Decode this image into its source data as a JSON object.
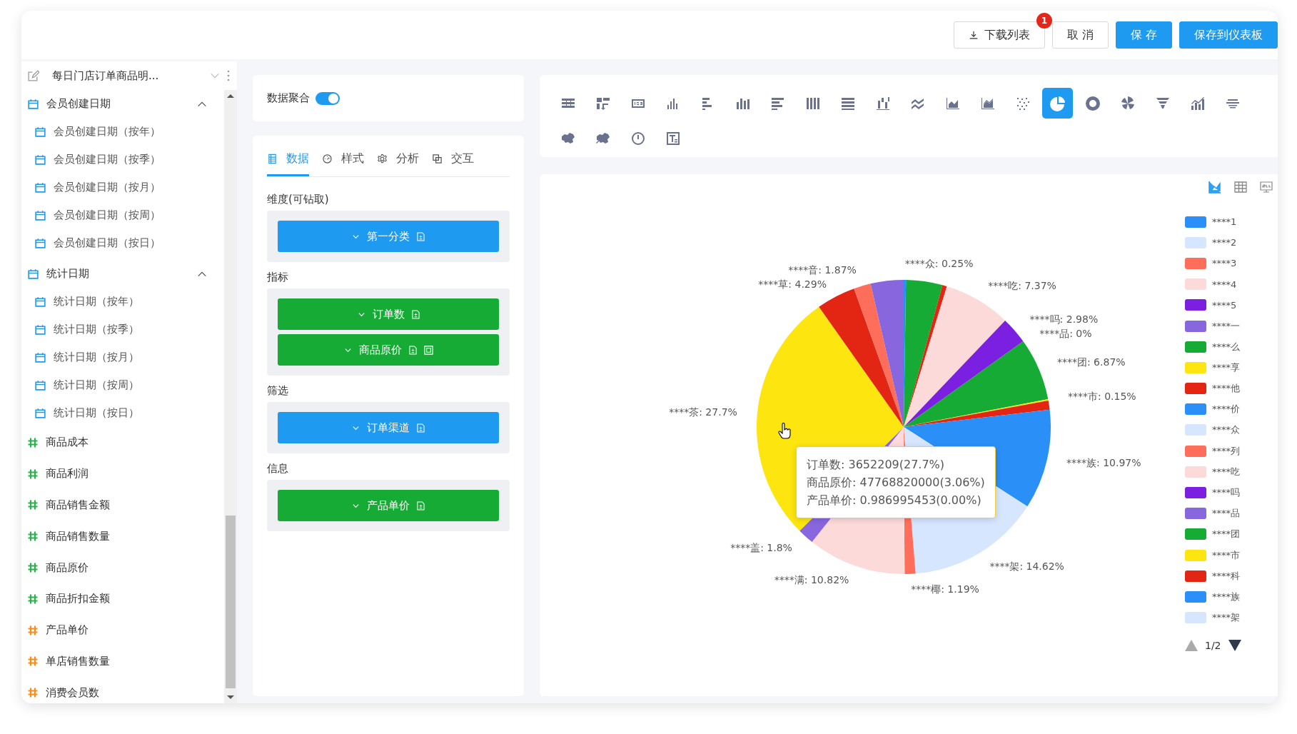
{
  "header": {
    "buttons": [
      {
        "label": "下载列表",
        "kind": "download",
        "badge": "1"
      },
      {
        "label": "取 消",
        "kind": "outline"
      },
      {
        "label": "保 存",
        "kind": "primary"
      },
      {
        "label": "保存到仪表板",
        "kind": "primary"
      }
    ]
  },
  "sidebar": {
    "dataset_title": "每日门店订单商品明...",
    "fields": [
      {
        "kind": "date-group",
        "label": "会员创建日期",
        "expanded": true,
        "children": [
          {
            "kind": "date",
            "label": "会员创建日期（按年）"
          },
          {
            "kind": "date",
            "label": "会员创建日期（按季）"
          },
          {
            "kind": "date",
            "label": "会员创建日期（按月）"
          },
          {
            "kind": "date",
            "label": "会员创建日期（按周）"
          },
          {
            "kind": "date",
            "label": "会员创建日期（按日）"
          }
        ]
      },
      {
        "kind": "date-group",
        "label": "统计日期",
        "expanded": true,
        "children": [
          {
            "kind": "date",
            "label": "统计日期（按年）"
          },
          {
            "kind": "date",
            "label": "统计日期（按季）"
          },
          {
            "kind": "date",
            "label": "统计日期（按月）"
          },
          {
            "kind": "date",
            "label": "统计日期（按周）"
          },
          {
            "kind": "date",
            "label": "统计日期（按日）"
          }
        ]
      },
      {
        "kind": "measure",
        "label": "商品成本",
        "color": "#2bb24c"
      },
      {
        "kind": "measure",
        "label": "商品利润",
        "color": "#2bb24c"
      },
      {
        "kind": "measure",
        "label": "商品销售金额",
        "color": "#2bb24c"
      },
      {
        "kind": "measure",
        "label": "商品销售数量",
        "color": "#2bb24c"
      },
      {
        "kind": "measure",
        "label": "商品原价",
        "color": "#2bb24c"
      },
      {
        "kind": "measure",
        "label": "商品折扣金额",
        "color": "#2bb24c"
      },
      {
        "kind": "measure",
        "label": "产品单价",
        "color": "#fa8c16"
      },
      {
        "kind": "measure",
        "label": "单店销售数量",
        "color": "#fa8c16"
      },
      {
        "kind": "measure",
        "label": "消费会员数",
        "color": "#fa8c16"
      }
    ]
  },
  "aggregate": {
    "label": "数据聚合",
    "on": true
  },
  "tabs": [
    {
      "label": "数据",
      "selected": true
    },
    {
      "label": "样式",
      "selected": false
    },
    {
      "label": "分析",
      "selected": false
    },
    {
      "label": "交互",
      "selected": false
    }
  ],
  "sections": [
    {
      "title": "维度(可钻取)",
      "fields": [
        {
          "label": "第一分类",
          "kind": "dimension",
          "extra_icon": false
        }
      ]
    },
    {
      "title": "指标",
      "fields": [
        {
          "label": "订单数",
          "kind": "measure",
          "extra_icon": false
        },
        {
          "label": "商品原价",
          "kind": "measure",
          "extra_icon": true
        }
      ]
    },
    {
      "title": "筛选",
      "fields": [
        {
          "label": "订单渠道",
          "kind": "dimension",
          "extra_icon": false
        }
      ]
    },
    {
      "title": "信息",
      "fields": [
        {
          "label": "产品单价",
          "kind": "measure",
          "extra_icon": false
        }
      ]
    }
  ],
  "chart_types": [
    {
      "kind": "table",
      "selected": false
    },
    {
      "kind": "pivot",
      "selected": false
    },
    {
      "kind": "number",
      "selected": false
    },
    {
      "kind": "bar-small",
      "selected": false
    },
    {
      "kind": "hbar",
      "selected": false
    },
    {
      "kind": "bar",
      "selected": false
    },
    {
      "kind": "hbar-long",
      "selected": false
    },
    {
      "kind": "column-stack",
      "selected": false
    },
    {
      "kind": "row-stack",
      "selected": false
    },
    {
      "kind": "waterfall",
      "selected": false
    },
    {
      "kind": "line",
      "selected": false
    },
    {
      "kind": "area",
      "selected": false
    },
    {
      "kind": "area-multi",
      "selected": false
    },
    {
      "kind": "scatter",
      "selected": false
    },
    {
      "kind": "pie",
      "selected": true
    },
    {
      "kind": "donut",
      "selected": false
    },
    {
      "kind": "rose",
      "selected": false
    },
    {
      "kind": "funnel",
      "selected": false
    },
    {
      "kind": "combo",
      "selected": false
    },
    {
      "kind": "wordcloud",
      "selected": false
    },
    {
      "kind": "map",
      "selected": false
    },
    {
      "kind": "map-flow",
      "selected": false
    },
    {
      "kind": "gauge",
      "selected": false
    },
    {
      "kind": "text",
      "selected": false
    }
  ],
  "chart_panel": {
    "views": [
      {
        "kind": "chart",
        "selected": true
      },
      {
        "kind": "table",
        "selected": false
      },
      {
        "kind": "sql",
        "selected": false
      }
    ],
    "chart_data": {
      "type": "pie",
      "data_labels": true,
      "values": [
        0.25,
        4.0,
        0.5,
        7.37,
        2.98,
        0,
        6.87,
        0.15,
        1.0,
        10.97,
        14.62,
        1.19,
        10.82,
        1.8,
        27.7,
        4.29,
        1.87,
        3.62
      ],
      "colors": [
        "#2a8ff7",
        "#16ab34",
        "#e32514",
        "#fddada",
        "#7b1fe0",
        "#8866dd",
        "#16ab34",
        "#fde50f",
        "#e32514",
        "#2a8ff7",
        "#d6e6ff",
        "#ff6e5a",
        "#fddada",
        "#8866dd",
        "#fde50f",
        "#e32514",
        "#ff6e5a",
        "#8866dd"
      ],
      "value_labels": [
        "****众: 0.25%",
        null,
        null,
        "****吃: 7.37%",
        "****吗: 2.98%",
        "****品: 0%",
        "****团: 6.87%",
        "****市: 0.15%",
        null,
        "****族: 10.97%",
        "****架: 14.62%",
        "****椰: 1.19%",
        "****满: 10.82%",
        "****盖: 1.8%",
        "****茶: 27.7%",
        "****草: 4.29%",
        "****音: 1.87%",
        null
      ]
    },
    "tooltip": {
      "lines": [
        "订单数: 3652209(27.7%)",
        "商品原价: 47768820000(3.06%)",
        "产品单价: 0.986995453(0.00%)"
      ]
    },
    "legend": {
      "page": "1/2",
      "items": [
        {
          "label": "****1",
          "color": "#2a8ff7"
        },
        {
          "label": "****2",
          "color": "#d6e6ff"
        },
        {
          "label": "****3",
          "color": "#ff6e5a"
        },
        {
          "label": "****4",
          "color": "#fddada"
        },
        {
          "label": "****5",
          "color": "#7b1fe0"
        },
        {
          "label": "****一",
          "color": "#8866dd"
        },
        {
          "label": "****么",
          "color": "#16ab34"
        },
        {
          "label": "****享",
          "color": "#fde50f"
        },
        {
          "label": "****他",
          "color": "#e32514"
        },
        {
          "label": "****价",
          "color": "#2a8ff7"
        },
        {
          "label": "****众",
          "color": "#d6e6ff"
        },
        {
          "label": "****列",
          "color": "#ff6e5a"
        },
        {
          "label": "****吃",
          "color": "#fddada"
        },
        {
          "label": "****吗",
          "color": "#7b1fe0"
        },
        {
          "label": "****品",
          "color": "#8866dd"
        },
        {
          "label": "****团",
          "color": "#16ab34"
        },
        {
          "label": "****市",
          "color": "#fde50f"
        },
        {
          "label": "****科",
          "color": "#e32514"
        },
        {
          "label": "****族",
          "color": "#2a8ff7"
        },
        {
          "label": "****架",
          "color": "#d6e6ff"
        }
      ]
    }
  }
}
